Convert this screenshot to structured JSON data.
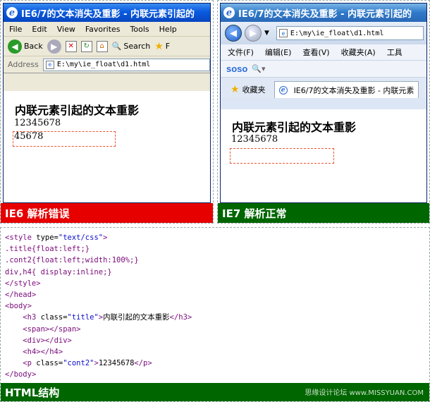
{
  "ie6": {
    "window_title": "IE6/7的文本消失及重影 - 内联元素引起的",
    "menu": [
      "File",
      "Edit",
      "View",
      "Favorites",
      "Tools",
      "Help"
    ],
    "toolbar": {
      "back": "Back",
      "search": "Search",
      "favorites": "F"
    },
    "address_label": "Address",
    "address_value": "E:\\my\\ie_float\\d1.html",
    "page": {
      "heading": "内联元素引起的文本重影",
      "line1": "12345678",
      "line2": "45678"
    },
    "banner": "IE6 解析错误"
  },
  "ie7": {
    "window_title": "IE6/7的文本消失及重影 - 内联元素引起的",
    "address_value": "E:\\my\\ie_float\\d1.html",
    "menu": [
      "文件(F)",
      "编辑(E)",
      "查看(V)",
      "收藏夹(A)",
      "工具"
    ],
    "search_logo": "soso",
    "favorites_label": "收藏夹",
    "tab_title": "IE6/7的文本消失及重影 - 内联元素",
    "page": {
      "heading": "内联元素引起的文本重影",
      "line1": "12345678"
    },
    "banner": "IE7 解析正常"
  },
  "code": {
    "lines": [
      "<style type=\"text/css\">",
      ".title{float:left;}",
      ".cont2{float:left;width:100%;}",
      "div,h4{ display:inline;}",
      "</style>",
      "</head>",
      "<body>",
      "    <h3 class=\"title\">内联引起的文本重影</h3>",
      "    <span></span>",
      "    <div></div>",
      "    <h4></h4>",
      "    <p class=\"cont2\">12345678</p>",
      "</body>"
    ],
    "banner": "HTML结构",
    "watermark": "思缘设计论坛 www.MISSYUAN.COM"
  },
  "colors": {
    "ie6_banner": "#e60000",
    "ie7_banner": "#006600",
    "ghost_box": "#e53"
  }
}
